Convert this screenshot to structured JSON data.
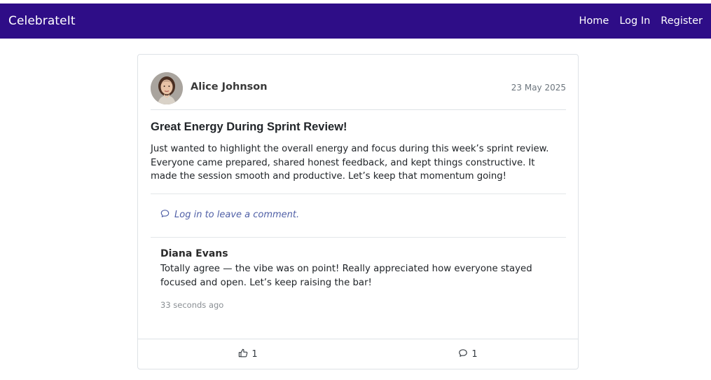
{
  "nav": {
    "brand": "CelebrateIt",
    "links": [
      "Home",
      "Log In",
      "Register"
    ]
  },
  "post": {
    "author": "Alice Johnson",
    "date": "23 May 2025",
    "title": "Great Energy During Sprint Review!",
    "body": "Just wanted to highlight the overall energy and focus during this week’s sprint review. Everyone came prepared, shared honest feedback, and kept things constructive. It made the session smooth and productive. Let’s keep that momentum going!",
    "login_prompt": "Log in to leave a comment.",
    "likes": "1",
    "comments_count": "1"
  },
  "comments": [
    {
      "author": "Diana Evans",
      "text": "Totally agree — the vibe was on point! Really appreciated how everyone stayed focused and open. Let’s keep raising the bar!",
      "time": "33 seconds ago"
    }
  ],
  "icons": {
    "comment": "chat-bubble-icon",
    "like": "thumbs-up-icon"
  },
  "colors": {
    "navbar": "#2e0d87",
    "link": "#4f5fa6"
  }
}
